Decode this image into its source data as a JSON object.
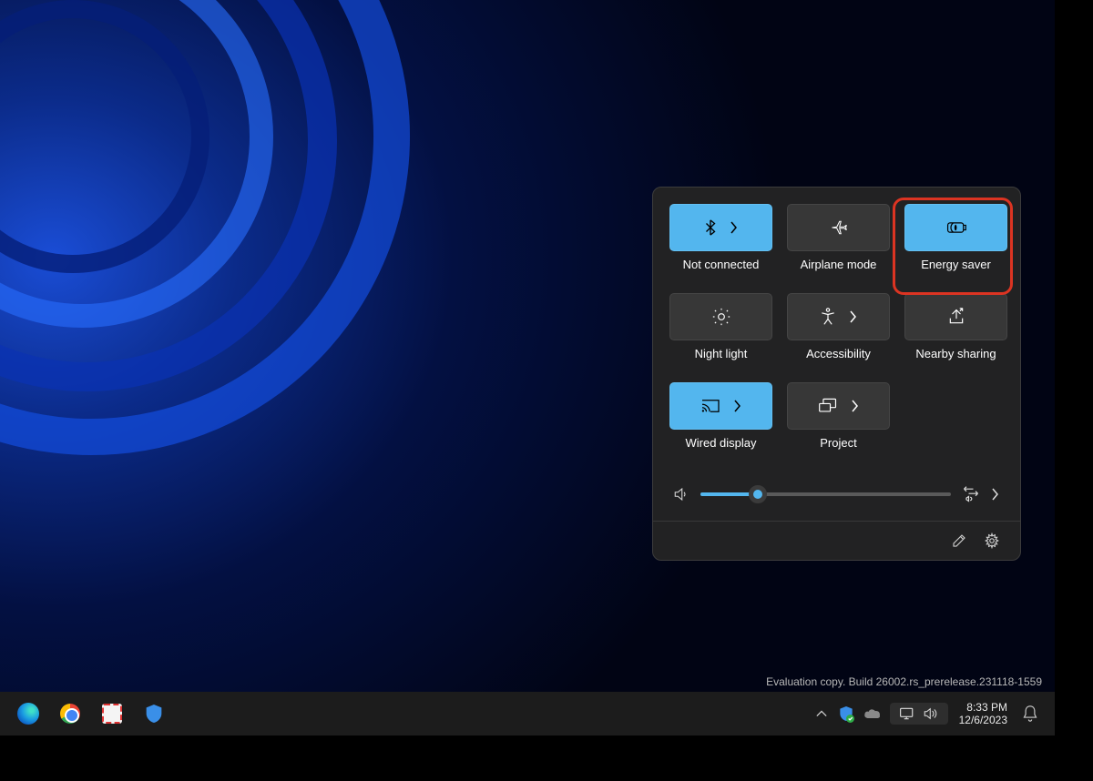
{
  "quick_settings": {
    "tiles": {
      "bluetooth": {
        "label": "Not connected",
        "active": true,
        "has_chevron": true,
        "icon": "bluetooth-icon"
      },
      "airplane": {
        "label": "Airplane mode",
        "active": false,
        "has_chevron": false,
        "icon": "airplane-icon"
      },
      "energy": {
        "label": "Energy saver",
        "active": true,
        "has_chevron": false,
        "icon": "energy-saver-icon"
      },
      "nightlight": {
        "label": "Night light",
        "active": false,
        "has_chevron": false,
        "icon": "night-light-icon"
      },
      "accessibility": {
        "label": "Accessibility",
        "active": false,
        "has_chevron": true,
        "icon": "accessibility-icon"
      },
      "nearby": {
        "label": "Nearby sharing",
        "active": false,
        "has_chevron": false,
        "icon": "nearby-sharing-icon"
      },
      "cast": {
        "label": "Wired display",
        "active": true,
        "has_chevron": true,
        "icon": "cast-icon"
      },
      "project": {
        "label": "Project",
        "active": false,
        "has_chevron": true,
        "icon": "project-icon"
      }
    },
    "volume_percent": 23
  },
  "watermark": {
    "line2": "Evaluation copy. Build 26002.rs_prerelease.231118-1559"
  },
  "taskbar": {
    "clock_time": "8:33 PM",
    "clock_date": "12/6/2023"
  }
}
